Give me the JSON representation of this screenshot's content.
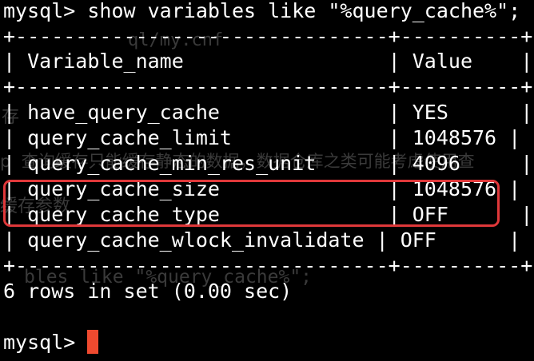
{
  "terminal": {
    "command": "mysql> show variables like \"%query_cache%\";",
    "border_line": "+-------------------------------+----------+",
    "header_row": "| Variable_name                 | Value    |",
    "rows": [
      "| have_query_cache              | YES      |",
      "| query_cache_limit             | 1048576 |",
      "| query_cache_min_res_unit      | 4096     |",
      "| query_cache_size              | 1048576 |",
      "| query_cache_type              | OFF      |",
      "| query_cache_wlock_invalidate | OFF      |"
    ],
    "result_summary": "6 rows in set (0.00 sec)",
    "prompt": "mysql> "
  },
  "background_ghost_text": {
    "ghost_1": "ql/my.cnf",
    "ghost_2": "存",
    "ghost_3": "p  查询缓存只能缓存静态的数据，数据仓库之类可能考虑使用查",
    "ghost_4": "缓存参数",
    "ghost_5": "bles like \"%query_cache%\";"
  },
  "colors": {
    "background": "#000000",
    "text": "#ffffff",
    "highlight_border": "#e0383a",
    "cursor": "#ef4a2f",
    "ghost_text": "#3a3a3a"
  }
}
